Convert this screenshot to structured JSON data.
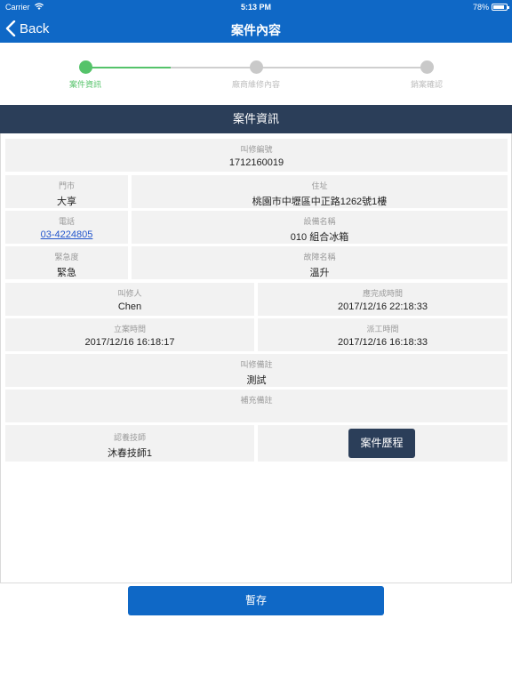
{
  "status_bar": {
    "carrier": "Carrier",
    "time": "5:13 PM",
    "battery": "78%",
    "wifi_icon": "wifi-icon",
    "battery_icon": "battery-icon"
  },
  "nav": {
    "back_label": "Back",
    "title": "案件內容"
  },
  "stepper": {
    "steps": [
      {
        "label": "案件資訊",
        "state": "active"
      },
      {
        "label": "廠商維修內容",
        "state": "pending"
      },
      {
        "label": "銷案確認",
        "state": "pending"
      }
    ],
    "colors": {
      "active": "#55c36a",
      "pending": "#c9c9c9"
    }
  },
  "section": {
    "title": "案件資訊"
  },
  "fields": {
    "repair_no": {
      "label": "叫修編號",
      "value": "1712160019"
    },
    "store": {
      "label": "門市",
      "value": "大享"
    },
    "address": {
      "label": "住址",
      "value": "桃園市中壢區中正路1262號1樓"
    },
    "phone": {
      "label": "電話",
      "value": "03-4224805"
    },
    "equipment": {
      "label": "設備名稱",
      "value": "010 組合冰箱"
    },
    "urgency": {
      "label": "緊急度",
      "value": "緊急"
    },
    "fault": {
      "label": "故障名稱",
      "value": "溫升"
    },
    "reporter": {
      "label": "叫修人",
      "value": "Chen"
    },
    "due_time": {
      "label": "應完成時間",
      "value": "2017/12/16 22:18:33"
    },
    "open_time": {
      "label": "立案時間",
      "value": "2017/12/16 16:18:17"
    },
    "dispatch_time": {
      "label": "派工時間",
      "value": "2017/12/16 16:18:33"
    },
    "note": {
      "label": "叫修備註",
      "value": "測試"
    },
    "extra_note": {
      "label": "補充備註",
      "value": ""
    },
    "technician": {
      "label": "認養技師",
      "value": "沐春技師1"
    }
  },
  "buttons": {
    "history": "案件歷程",
    "save": "暫存"
  },
  "colors": {
    "nav_bar": "#0f68c6",
    "section_header": "#2b3e59",
    "cell_bg": "#f2f2f2",
    "link": "#2255cc"
  }
}
